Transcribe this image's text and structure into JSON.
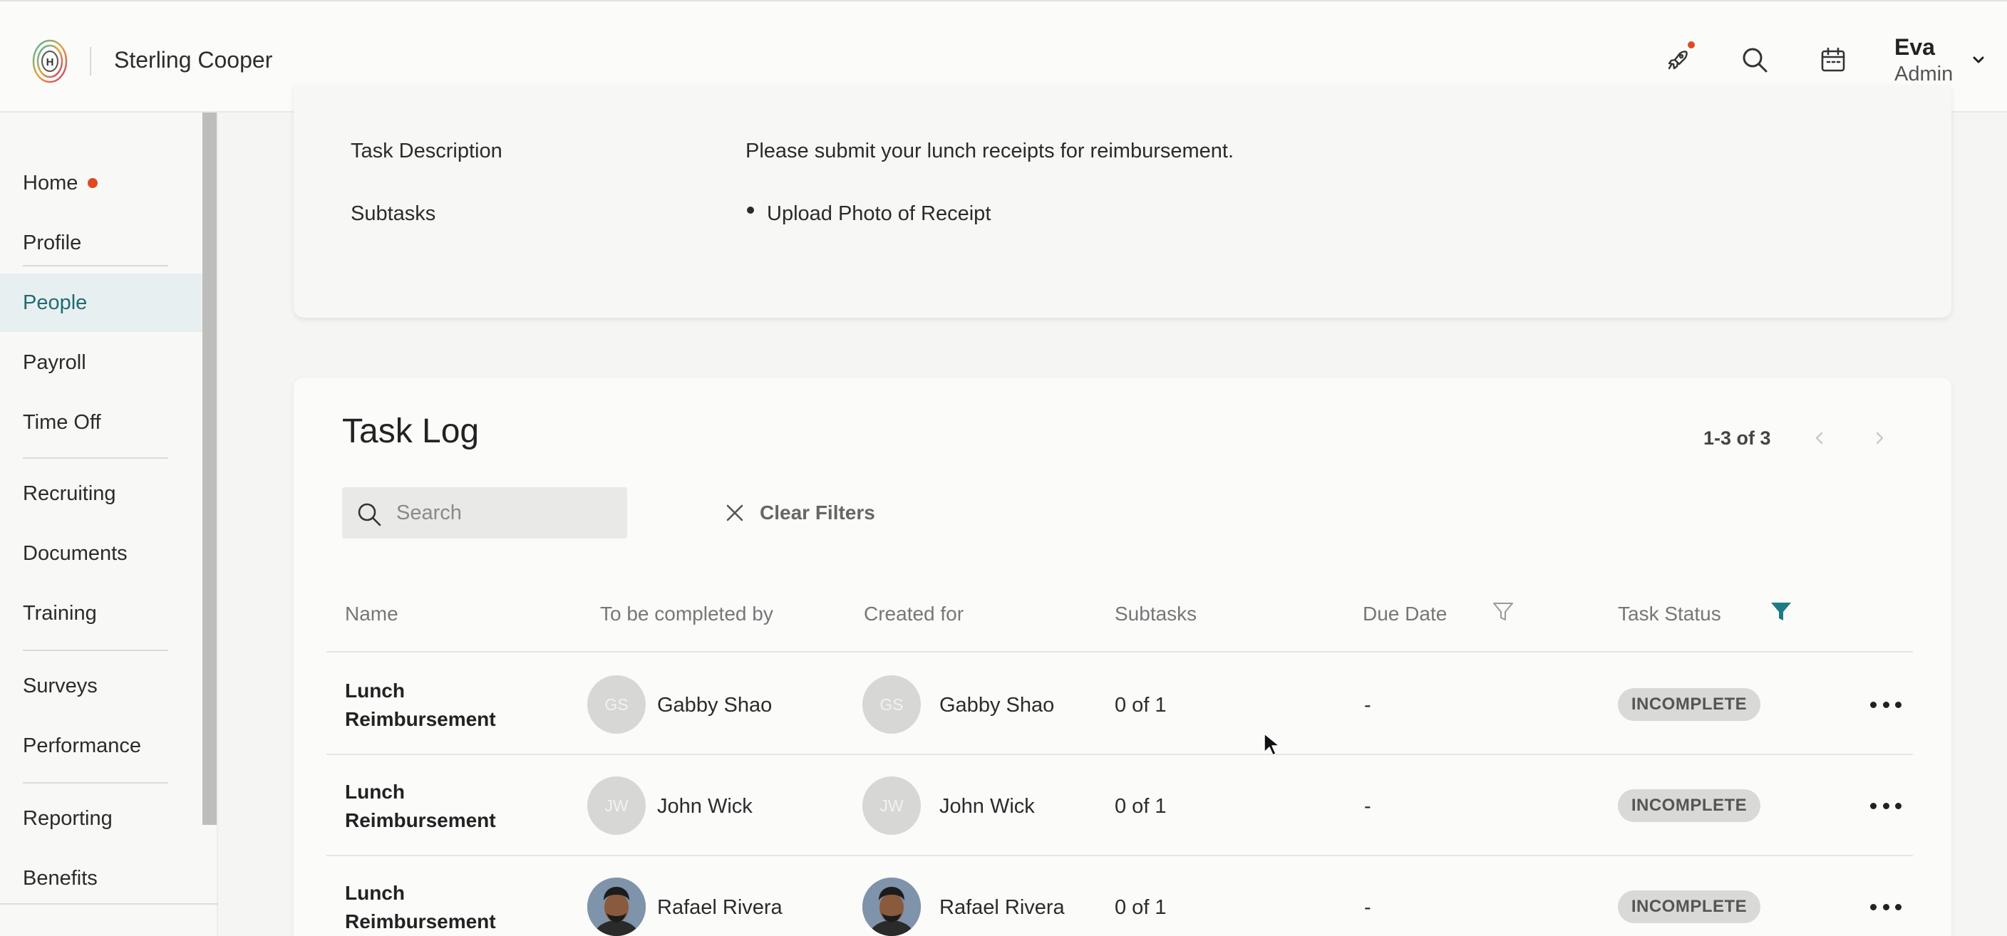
{
  "header": {
    "company": "Sterling Cooper",
    "user_name": "Eva",
    "user_role": "Admin"
  },
  "icons": {
    "logo": "fingerprint-logo-icon",
    "rocket": "rocket-icon",
    "search": "search-icon",
    "calendar": "calendar-icon",
    "chevron": "chevron-down-icon"
  },
  "colors": {
    "accent": "#1f6b74",
    "notification": "#e0491f",
    "active_filter": "#1f7a85"
  },
  "sidebar": {
    "items": [
      {
        "label": "Home"
      },
      {
        "label": "Profile"
      },
      {
        "label": "People"
      },
      {
        "label": "Payroll"
      },
      {
        "label": "Time Off"
      },
      {
        "label": "Recruiting"
      },
      {
        "label": "Documents"
      },
      {
        "label": "Training"
      },
      {
        "label": "Surveys"
      },
      {
        "label": "Performance"
      },
      {
        "label": "Reporting"
      },
      {
        "label": "Benefits"
      }
    ],
    "active": "People"
  },
  "task_details": {
    "description_label": "Task Description",
    "description_value": "Please submit your lunch receipts for reimbursement.",
    "subtasks_label": "Subtasks",
    "subtasks": [
      "Upload Photo of Receipt"
    ]
  },
  "task_log": {
    "title": "Task Log",
    "pagination": "1-3 of 3",
    "search_placeholder": "Search",
    "clear_filters": "Clear Filters",
    "columns": {
      "name": "Name",
      "completed_by": "To be completed by",
      "created_for": "Created for",
      "subtasks": "Subtasks",
      "due_date": "Due Date",
      "status": "Task Status"
    },
    "rows": [
      {
        "name_line1": "Lunch",
        "name_line2": "Reimbursement",
        "completed_by": "Gabby Shao",
        "completed_by_initials": "GS",
        "created_for": "Gabby Shao",
        "created_for_initials": "GS",
        "subtasks": "0 of 1",
        "due_date": "-",
        "status": "INCOMPLETE"
      },
      {
        "name_line1": "Lunch",
        "name_line2": "Reimbursement",
        "completed_by": "John Wick",
        "completed_by_initials": "JW",
        "created_for": "John Wick",
        "created_for_initials": "JW",
        "subtasks": "0 of 1",
        "due_date": "-",
        "status": "INCOMPLETE"
      },
      {
        "name_line1": "Lunch",
        "name_line2": "Reimbursement",
        "completed_by": "Rafael Rivera",
        "created_for": "Rafael Rivera",
        "subtasks": "0 of 1",
        "due_date": "-",
        "status": "INCOMPLETE"
      }
    ]
  }
}
